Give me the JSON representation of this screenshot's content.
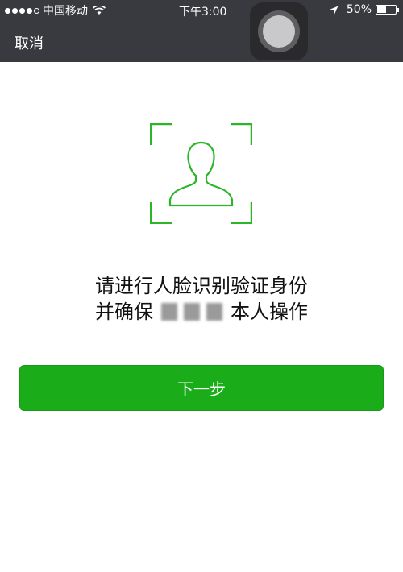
{
  "status_bar": {
    "carrier": "中国移动",
    "time": "下午3:00",
    "battery": "50%",
    "battery_level": 0.5
  },
  "nav": {
    "cancel_label": "取消"
  },
  "prompt": {
    "line1": "请进行人脸识别验证身份",
    "line2_prefix": "并确保",
    "line2_suffix": "本人操作"
  },
  "actions": {
    "next_label": "下一步"
  },
  "colors": {
    "topbar": "#393a3f",
    "accent_green": "#1aad19",
    "frame_green": "#2db52a"
  },
  "icons": {
    "face": "person-silhouette-icon",
    "wifi": "wifi-icon",
    "location": "location-arrow-icon",
    "battery": "battery-icon"
  }
}
